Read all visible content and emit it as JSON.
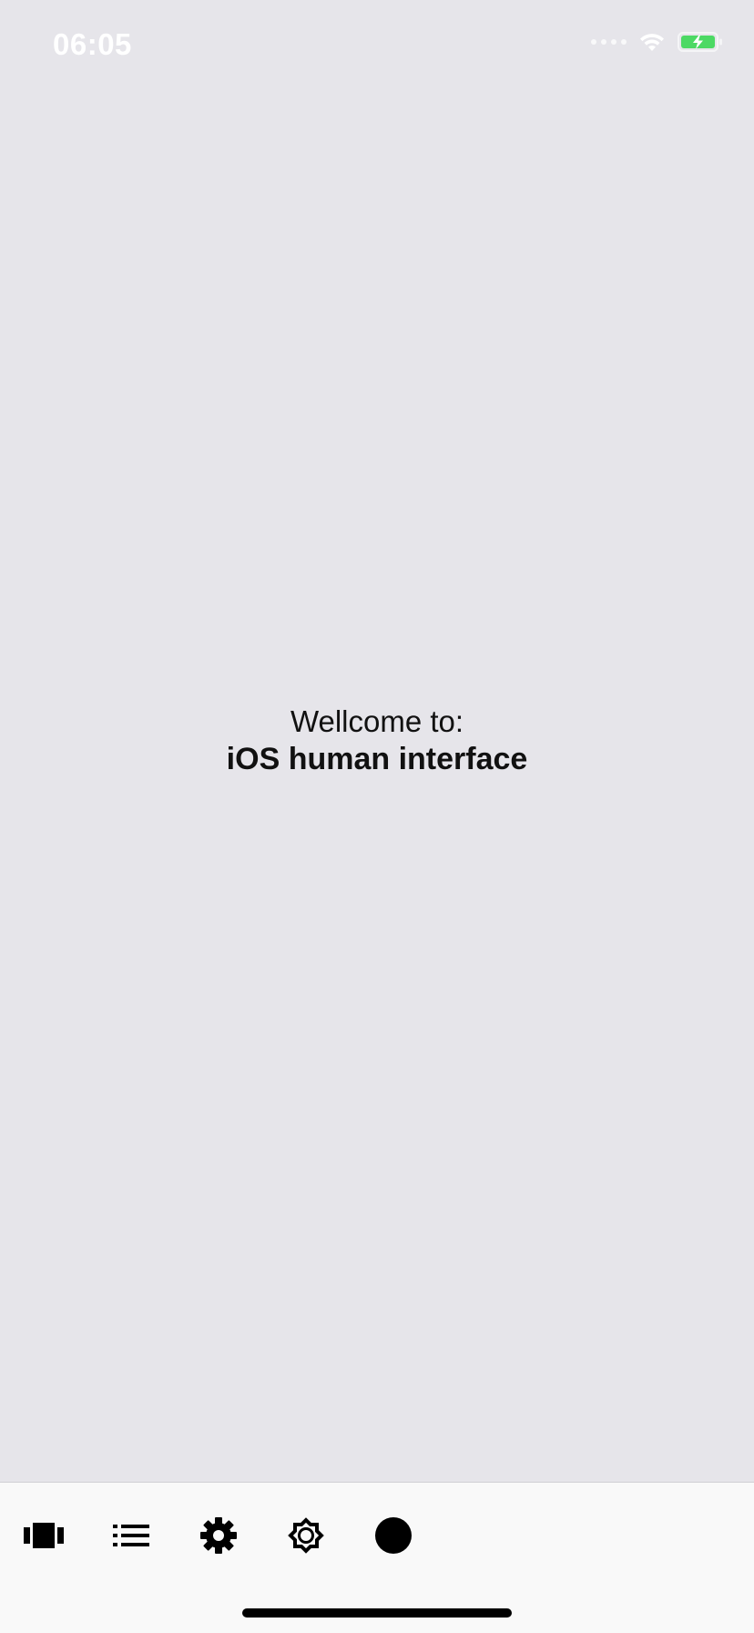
{
  "status_bar": {
    "time": "06:05",
    "battery_color": "#4cd964",
    "wifi_icon": "wifi-icon",
    "signal_icon": "cellular-signal-icon",
    "battery_icon": "battery-charging-icon"
  },
  "welcome": {
    "line1": "Wellcome to:",
    "line2": "iOS human interface"
  },
  "tab_bar": {
    "items": [
      {
        "icon": "carousel-icon"
      },
      {
        "icon": "list-icon"
      },
      {
        "icon": "gear-icon"
      },
      {
        "icon": "badge-gear-icon"
      },
      {
        "icon": "circle-icon"
      }
    ]
  },
  "colors": {
    "background": "#e6e5ea",
    "tab_bar_background": "#f9f9f9",
    "text": "#111111"
  }
}
